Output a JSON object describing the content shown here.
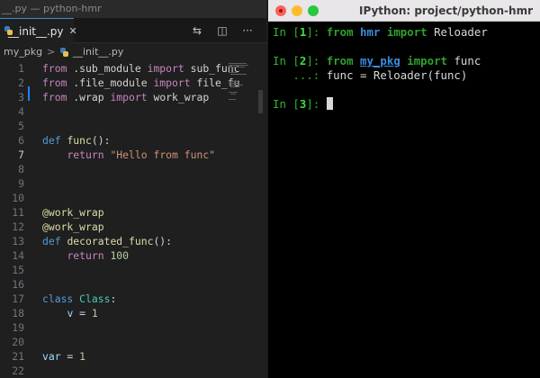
{
  "vscode": {
    "window_title": "__.py — python-hmr",
    "tab": {
      "label": "__init__.py",
      "close": "✕"
    },
    "toolbar": {
      "compare_icon": "⇆",
      "split_icon": "◫",
      "more_icon": "···"
    },
    "breadcrumb": {
      "package": "my_pkg",
      "separator": ">",
      "file": "__init__.py"
    },
    "active_line": 7,
    "code_lines": [
      {
        "n": "1",
        "parts": [
          [
            "kw",
            "from"
          ],
          [
            "",
            " .sub_module "
          ],
          [
            "kw",
            "import"
          ],
          [
            "",
            " sub_func"
          ]
        ]
      },
      {
        "n": "2",
        "parts": [
          [
            "kw",
            "from"
          ],
          [
            "",
            " .file_module "
          ],
          [
            "kw",
            "import"
          ],
          [
            "",
            " file_fu"
          ]
        ]
      },
      {
        "n": "3",
        "parts": [
          [
            "kw",
            "from"
          ],
          [
            "",
            " .wrap "
          ],
          [
            "kw",
            "import"
          ],
          [
            "",
            " work_wrap"
          ]
        ]
      },
      {
        "n": "4",
        "parts": []
      },
      {
        "n": "5",
        "parts": []
      },
      {
        "n": "6",
        "parts": [
          [
            "kwb",
            "def"
          ],
          [
            "",
            " "
          ],
          [
            "fn",
            "func"
          ],
          [
            "",
            "():"
          ]
        ]
      },
      {
        "n": "7",
        "parts": [
          [
            "",
            "    "
          ],
          [
            "kw",
            "return"
          ],
          [
            "",
            " "
          ],
          [
            "str",
            "\"Hello from func\""
          ]
        ]
      },
      {
        "n": "8",
        "parts": []
      },
      {
        "n": "9",
        "parts": []
      },
      {
        "n": "10",
        "parts": []
      },
      {
        "n": "11",
        "parts": [
          [
            "fn",
            "@work_wrap"
          ]
        ]
      },
      {
        "n": "12",
        "parts": [
          [
            "fn",
            "@work_wrap"
          ]
        ]
      },
      {
        "n": "13",
        "parts": [
          [
            "kwb",
            "def"
          ],
          [
            "",
            " "
          ],
          [
            "fn",
            "decorated_func"
          ],
          [
            "",
            "():"
          ]
        ]
      },
      {
        "n": "14",
        "parts": [
          [
            "",
            "    "
          ],
          [
            "kw",
            "return"
          ],
          [
            "",
            " "
          ],
          [
            "num",
            "100"
          ]
        ]
      },
      {
        "n": "15",
        "parts": []
      },
      {
        "n": "16",
        "parts": []
      },
      {
        "n": "17",
        "parts": [
          [
            "kwb",
            "class"
          ],
          [
            "",
            " "
          ],
          [
            "cls",
            "Class"
          ],
          [
            "",
            ":"
          ]
        ]
      },
      {
        "n": "18",
        "parts": [
          [
            "",
            "    "
          ],
          [
            "var",
            "v"
          ],
          [
            "",
            " = "
          ],
          [
            "num",
            "1"
          ]
        ]
      },
      {
        "n": "19",
        "parts": []
      },
      {
        "n": "20",
        "parts": []
      },
      {
        "n": "21",
        "parts": [
          [
            "var",
            "var"
          ],
          [
            "",
            " = "
          ],
          [
            "num",
            "1"
          ]
        ]
      },
      {
        "n": "22",
        "parts": []
      }
    ]
  },
  "terminal": {
    "title": "IPython: project/python-hmr",
    "lines": [
      {
        "parts": [
          [
            "pg",
            "In ["
          ],
          [
            "pgb",
            "1"
          ],
          [
            "pg",
            "]: "
          ],
          [
            "tkw",
            "from"
          ],
          [
            "",
            " "
          ],
          [
            "tmod",
            "hmr"
          ],
          [
            "",
            " "
          ],
          [
            "tkw",
            "import"
          ],
          [
            "",
            " Reloader"
          ]
        ]
      },
      {
        "parts": []
      },
      {
        "parts": [
          [
            "pg",
            "In ["
          ],
          [
            "pgb",
            "2"
          ],
          [
            "pg",
            "]: "
          ],
          [
            "tkw",
            "from"
          ],
          [
            "",
            " "
          ],
          [
            "tmodu",
            "my_pkg"
          ],
          [
            "",
            " "
          ],
          [
            "tkw",
            "import"
          ],
          [
            "",
            " func"
          ]
        ]
      },
      {
        "parts": [
          [
            "pg",
            "   ...: "
          ],
          [
            "",
            "func = Reloader(func)"
          ]
        ]
      },
      {
        "parts": []
      },
      {
        "parts": [
          [
            "pg",
            "In ["
          ],
          [
            "pgb",
            "3"
          ],
          [
            "pg",
            "]: "
          ]
        ],
        "cursor": true
      }
    ]
  },
  "colors": {
    "accent_tab": "#3a8fd6",
    "prompt_green": "#2cb52c",
    "module_blue": "#3b8de0",
    "traffic_close": "#fe5f57",
    "traffic_min": "#febc2e",
    "traffic_max": "#28c840"
  }
}
